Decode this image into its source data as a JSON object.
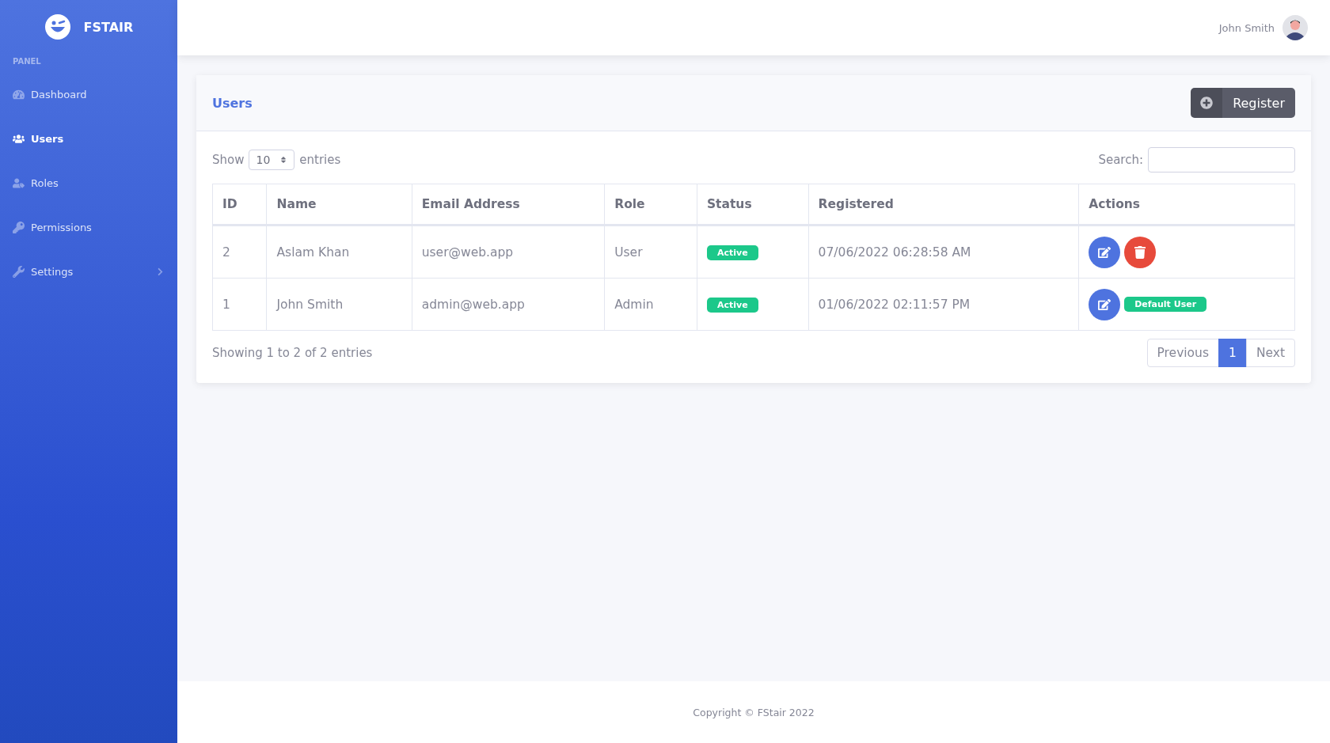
{
  "sidebar": {
    "brand": "FSTAIR",
    "section": "PANEL",
    "items": [
      {
        "label": "Dashboard",
        "selected": false,
        "has_submenu": false
      },
      {
        "label": "Users",
        "selected": true,
        "has_submenu": false
      },
      {
        "label": "Roles",
        "selected": false,
        "has_submenu": false
      },
      {
        "label": "Permissions",
        "selected": false,
        "has_submenu": false
      },
      {
        "label": "Settings",
        "selected": false,
        "has_submenu": true
      }
    ]
  },
  "topbar": {
    "user_name": "John Smith"
  },
  "card": {
    "title": "Users",
    "register_button": "Register",
    "show_label": "Show",
    "entries_value": "10",
    "entries_label": "entries",
    "search_label": "Search:",
    "table": {
      "columns": [
        "ID",
        "Name",
        "Email Address",
        "Role",
        "Status",
        "Registered",
        "Actions"
      ],
      "rows": [
        {
          "id": "2",
          "name": "Aslam Khan",
          "email": "user@web.app",
          "role": "User",
          "status": "Active",
          "registered": "07/06/2022 06:28:58 AM",
          "actions": [
            {
              "kind": "edit"
            },
            {
              "kind": "delete"
            }
          ]
        },
        {
          "id": "1",
          "name": "John Smith",
          "email": "admin@web.app",
          "role": "Admin",
          "status": "Active",
          "registered": "01/06/2022 02:11:57 PM",
          "actions": [
            {
              "kind": "edit"
            },
            {
              "kind": "badge",
              "label": "Default User"
            }
          ]
        }
      ]
    },
    "info": "Showing 1 to 2 of 2 entries",
    "pagination": [
      {
        "label": "Previous",
        "selected": false
      },
      {
        "label": "1",
        "selected": true
      },
      {
        "label": "Next",
        "selected": false
      }
    ]
  },
  "footer": "Copyright © FStair 2022"
}
